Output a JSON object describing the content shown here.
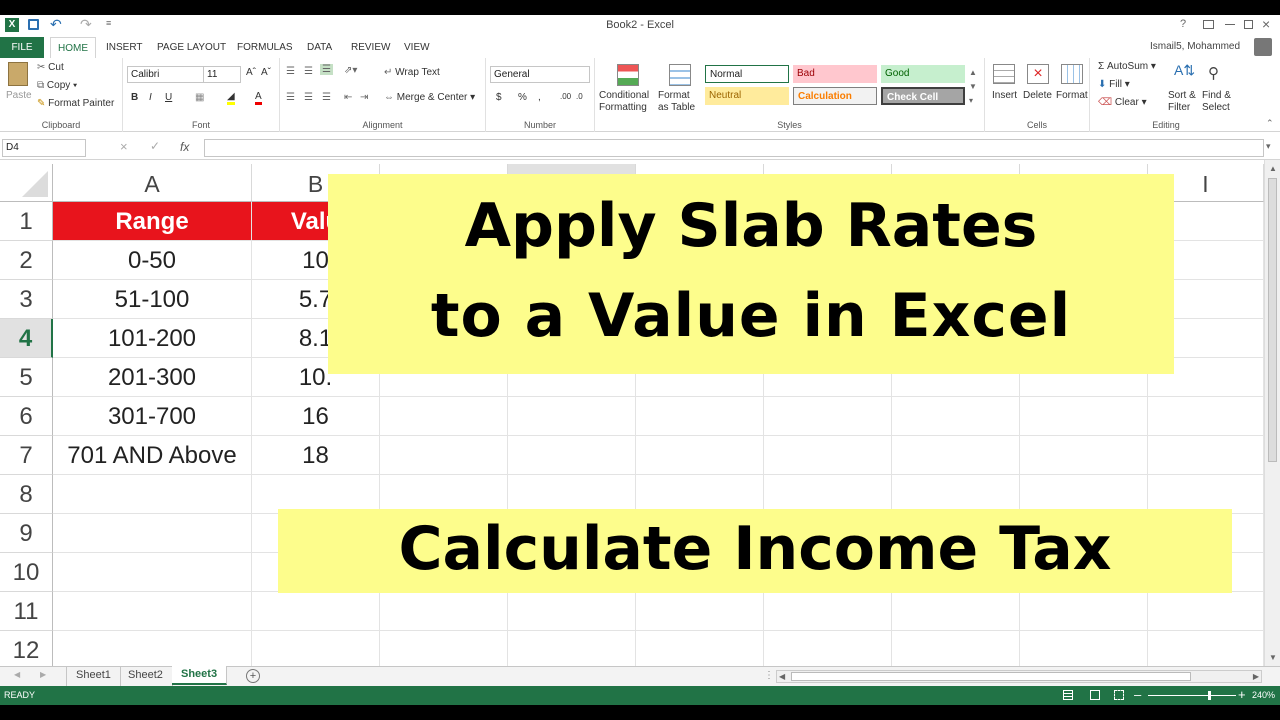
{
  "window": {
    "title": "Book2 - Excel",
    "user": "Ismail5, Mohammed",
    "help": "?"
  },
  "menu": [
    "FILE",
    "HOME",
    "INSERT",
    "PAGE LAYOUT",
    "FORMULAS",
    "DATA",
    "REVIEW",
    "VIEW"
  ],
  "clipboard": {
    "paste": "Paste",
    "cut": "Cut",
    "copy": "Copy",
    "format_painter": "Format Painter",
    "label": "Clipboard"
  },
  "font": {
    "name": "Calibri",
    "size": "11",
    "label": "Font",
    "bold": "B",
    "italic": "I",
    "underline": "U"
  },
  "alignment": {
    "wrap_text": "Wrap Text",
    "merge_center": "Merge & Center",
    "label": "Alignment"
  },
  "number": {
    "format": "General",
    "dollar": "$",
    "percent": "%",
    "comma": ",",
    "label": "Number"
  },
  "styles": {
    "conditional": "Conditional Formatting",
    "format_table": "Format as Table",
    "normal": "Normal",
    "bad": "Bad",
    "good": "Good",
    "neutral": "Neutral",
    "calculation": "Calculation",
    "check_cell": "Check Cell",
    "label": "Styles"
  },
  "cells": {
    "insert": "Insert",
    "delete": "Delete",
    "format": "Format",
    "label": "Cells"
  },
  "editing": {
    "autosum": "AutoSum",
    "fill": "Fill",
    "clear": "Clear",
    "sort_filter": "Sort & Filter",
    "find_select": "Find & Select",
    "label": "Editing"
  },
  "formula_bar": {
    "name_box": "D4",
    "fx": "fx",
    "value": ""
  },
  "columns": [
    "A",
    "B",
    "",
    "",
    "",
    "",
    "",
    "",
    "",
    "I"
  ],
  "rows": [
    "1",
    "2",
    "3",
    "4",
    "5",
    "6",
    "7",
    "8",
    "9",
    "10",
    "11",
    "12"
  ],
  "table": {
    "header": {
      "range": "Range",
      "value": "Valu"
    },
    "rows": [
      {
        "range": "0-50",
        "value": "10"
      },
      {
        "range": "51-100",
        "value": "5.7"
      },
      {
        "range": "101-200",
        "value": "8.1"
      },
      {
        "range": "201-300",
        "value": "10."
      },
      {
        "range": "301-700",
        "value": "16"
      },
      {
        "range": "701 AND Above",
        "value": "18"
      }
    ]
  },
  "overlay": {
    "line1": "Apply Slab Rates",
    "line2": "to a Value in Excel",
    "line3": "Calculate Income Tax"
  },
  "sheets": [
    "Sheet1",
    "Sheet2",
    "Sheet3"
  ],
  "active_sheet": "Sheet3",
  "status": {
    "text": "READY",
    "zoom": "240%"
  },
  "colors": {
    "excel_green": "#217346",
    "header_red": "#e8141c",
    "banner": "#fdfd8c",
    "active_row": "#217346"
  }
}
